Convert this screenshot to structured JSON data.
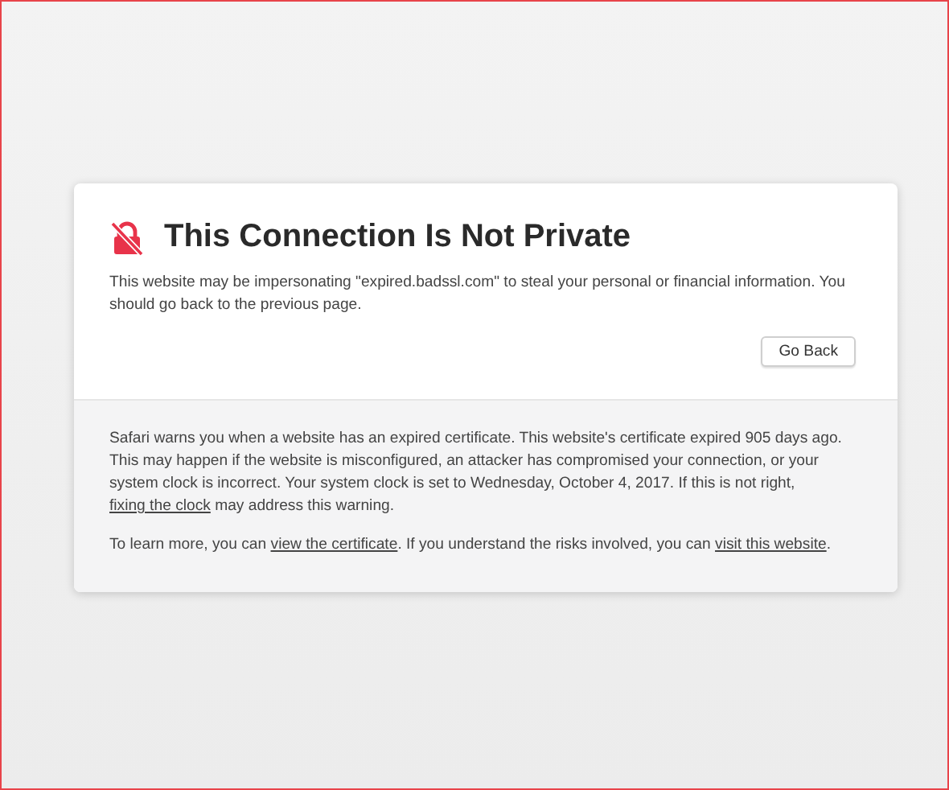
{
  "title": "This Connection Is Not Private",
  "message": "This website may be impersonating \"expired.badssl.com\" to steal your personal or financial information. You should go back to the previous page.",
  "button": "Go Back",
  "details": [
    [
      {
        "kind": "text",
        "text": "Safari warns you when a website has an expired certificate. This website's certificate expired 905 days ago. This may happen if the website is misconfigured, an attacker has compromised your connection, or your system clock is incorrect. Your system clock is set to Wednesday, October 4, 2017. If this is not right, "
      },
      {
        "kind": "link",
        "text": "fixing the clock"
      },
      {
        "kind": "text",
        "text": " may address this warning."
      }
    ],
    [
      {
        "kind": "text",
        "text": "To learn more, you can "
      },
      {
        "kind": "link",
        "text": "view the certificate"
      },
      {
        "kind": "text",
        "text": ". If you understand the risks involved, you can "
      },
      {
        "kind": "link",
        "text": "visit this website"
      },
      {
        "kind": "text",
        "text": "."
      }
    ]
  ]
}
